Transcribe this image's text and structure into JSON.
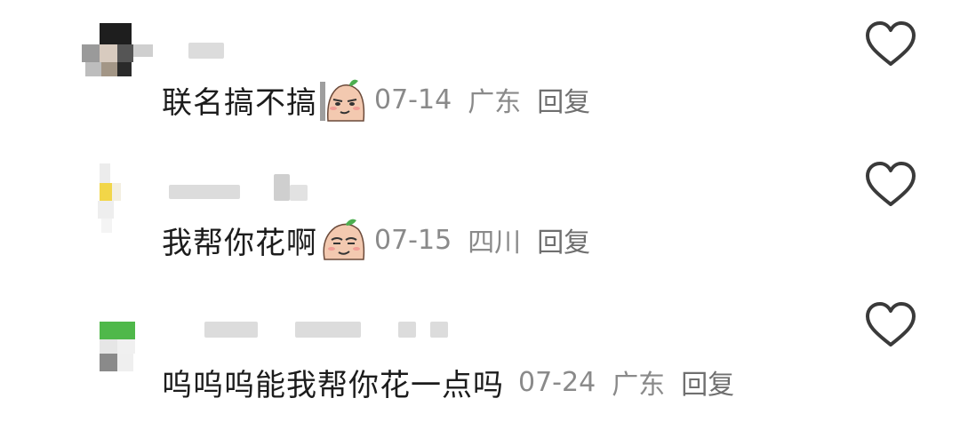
{
  "comments": [
    {
      "text": "联名搞不搞",
      "sticker": "smug-face-emoji",
      "date": "07-14",
      "location": "广东",
      "reply_label": "回复",
      "like_icon": "heart-outline-icon"
    },
    {
      "text": "我帮你花啊",
      "sticker": "smug-face-emoji",
      "date": "07-15",
      "location": "四川",
      "reply_label": "回复",
      "like_icon": "heart-outline-icon"
    },
    {
      "text": "呜呜呜能我帮你花一点吗",
      "date": "07-24",
      "location": "广东",
      "reply_label": "回复",
      "like_icon": "heart-outline-icon"
    }
  ],
  "colors": {
    "text": "#1c1c1c",
    "meta": "#8a8a8a",
    "heart_stroke": "#3a3a3a"
  }
}
